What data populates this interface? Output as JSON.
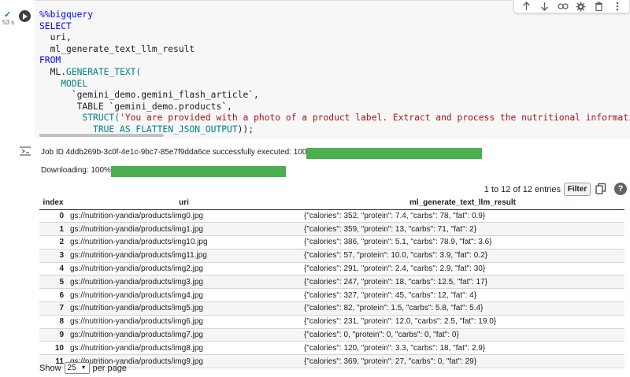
{
  "cell": {
    "exec_status_icon": "check-icon",
    "exec_time": "53 s",
    "code_lines": [
      [
        {
          "t": "%%bigquery",
          "c": "kw"
        }
      ],
      [
        {
          "t": "SELECT",
          "c": "kw"
        }
      ],
      [
        {
          "t": "  uri,",
          "c": "txt"
        }
      ],
      [
        {
          "t": "  ml_generate_text_llm_result",
          "c": "txt"
        }
      ],
      [
        {
          "t": "FROM",
          "c": "kw"
        }
      ],
      [
        {
          "t": "  ML.",
          "c": "txt"
        },
        {
          "t": "GENERATE_TEXT(",
          "c": "fn"
        }
      ],
      [
        {
          "t": "    MODEL",
          "c": "fn"
        }
      ],
      [
        {
          "t": "      `gemini_demo.gemini_flash_article`,",
          "c": "txt"
        }
      ],
      [
        {
          "t": "       TABLE `gemini_demo.products`,",
          "c": "txt"
        }
      ],
      [
        {
          "t": "        ",
          "c": "txt"
        },
        {
          "t": "STRUCT(",
          "c": "fn"
        },
        {
          "t": "'You are provided with a photo of a product label. Extract and process the nutritional information for :",
          "c": "str"
        }
      ],
      [
        {
          "t": "          TRUE AS FLATTEN_JSON_OUTPUT",
          "c": "fn"
        },
        {
          "t": "));",
          "c": "txt"
        }
      ]
    ]
  },
  "toolbar": {
    "icons": [
      "arrow-up-icon",
      "arrow-down-icon",
      "link-icon",
      "gear-icon",
      "trash-icon",
      "more-icon"
    ]
  },
  "output": {
    "job_text": "Job ID 4ddb269b-3c0f-4e1c-9bc7-85e7f9dda6ce successfully executed: 100%",
    "job_progress": 1.0,
    "download_text": "Downloading: 100%",
    "download_progress": 1.0,
    "progress_color": "#4caf50"
  },
  "table": {
    "pager_info": "1 to 12 of 12 entries",
    "filter_label": "Filter",
    "columns": [
      "index",
      "uri",
      "ml_generate_text_llm_result"
    ],
    "rows": [
      [
        "0",
        "gs://nutrition-yandia/products/img0.jpg",
        "{\"calories\": 352, \"protein\": 7.4, \"carbs\": 78, \"fat\": 0.9}"
      ],
      [
        "1",
        "gs://nutrition-yandia/products/img1.jpg",
        "{\"calories\": 359, \"protein\": 13, \"carbs\": 71, \"fat\": 2}"
      ],
      [
        "2",
        "gs://nutrition-yandia/products/img10.jpg",
        "{\"calories\": 386, \"protein\": 5.1, \"carbs\": 78.9, \"fat\": 3.6}"
      ],
      [
        "3",
        "gs://nutrition-yandia/products/img11.jpg",
        "{\"calories\": 57, \"protein\": 10.0, \"carbs\": 3.9, \"fat\": 0.2}"
      ],
      [
        "4",
        "gs://nutrition-yandia/products/img2.jpg",
        "{\"calories\": 291, \"protein\": 2.4, \"carbs\": 2.9, \"fat\": 30}"
      ],
      [
        "5",
        "gs://nutrition-yandia/products/img3.jpg",
        "{\"calories\": 247, \"protein\": 18, \"carbs\": 12.5, \"fat\": 17}"
      ],
      [
        "6",
        "gs://nutrition-yandia/products/img4.jpg",
        "{\"calories\": 327, \"protein\": 45, \"carbs\": 12, \"fat\": 4}"
      ],
      [
        "7",
        "gs://nutrition-yandia/products/img5.jpg",
        "{\"calories\": 82, \"protein\": 1.5, \"carbs\": 5.8, \"fat\": 5.4}"
      ],
      [
        "8",
        "gs://nutrition-yandia/products/img6.jpg",
        "{\"calories\": 231, \"protein\": 12.0, \"carbs\": 2.5, \"fat\": 19.0}"
      ],
      [
        "9",
        "gs://nutrition-yandia/products/img7.jpg",
        "{\"calories\": 0, \"protein\": 0, \"carbs\": 0, \"fat\": 0}"
      ],
      [
        "10",
        "gs://nutrition-yandia/products/img8.jpg",
        "{\"calories\": 120, \"protein\": 3.3, \"carbs\": 18, \"fat\": 2.9}"
      ],
      [
        "11",
        "gs://nutrition-yandia/products/img9.jpg",
        "{\"calories\": 369, \"protein\": 27, \"carbs\": 0, \"fat\": 29}"
      ]
    ],
    "show_label": "Show",
    "per_page_value": "25",
    "per_page_label": "per page"
  }
}
